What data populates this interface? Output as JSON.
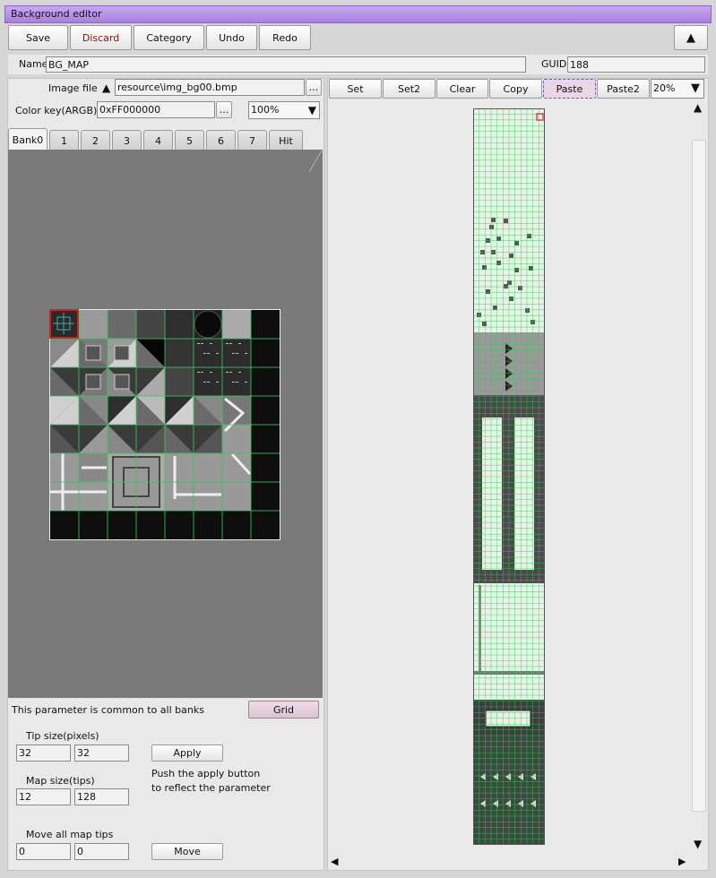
{
  "window": {
    "title": "Background editor"
  },
  "toolbar": {
    "save": "Save",
    "discard": "Discard",
    "category": "Category",
    "undo": "Undo",
    "redo": "Redo",
    "collapse": "▲"
  },
  "header": {
    "name_label": "Name",
    "name_value": "BG_MAP",
    "guid_label": "GUID",
    "guid_value": "188"
  },
  "image_file": {
    "label": "Image file",
    "arrow": "▲",
    "value": "resource\\img_bg00.bmp",
    "browse": "..."
  },
  "color_key": {
    "label": "Color key(ARGB)",
    "value": "0xFF000000",
    "browse": "...",
    "zoom": "100%",
    "zoom_arrow": "▼"
  },
  "banks": [
    "Bank0",
    "1",
    "2",
    "3",
    "4",
    "5",
    "6",
    "7",
    "Hit"
  ],
  "params": {
    "common_note": "This parameter is common to all banks",
    "grid_button": "Grid",
    "tip_size_label": "Tip size(pixels)",
    "tip_w": "32",
    "tip_h": "32",
    "apply_button": "Apply",
    "apply_note_1": "Push the apply button",
    "apply_note_2": "to reflect the parameter",
    "map_size_label": "Map size(tips)",
    "map_w": "12",
    "map_h": "128",
    "move_label": "Move all map tips",
    "move_x": "0",
    "move_y": "0",
    "move_button": "Move"
  },
  "map_toolbar": {
    "set": "Set",
    "set2": "Set2",
    "clear": "Clear",
    "copy": "Copy",
    "paste": "Paste",
    "paste2": "Paste2",
    "zoom": "20%",
    "zoom_arrow": "▼"
  },
  "scroll": {
    "up": "▲",
    "down": "▼",
    "left": "◀",
    "right": "▶"
  },
  "icons": {
    "tile_cursor": "tile-cursor-icon"
  },
  "colors": {
    "title_bar": "#a77fdf",
    "grid_line": "#3cc45a",
    "selection": "#d02020"
  }
}
